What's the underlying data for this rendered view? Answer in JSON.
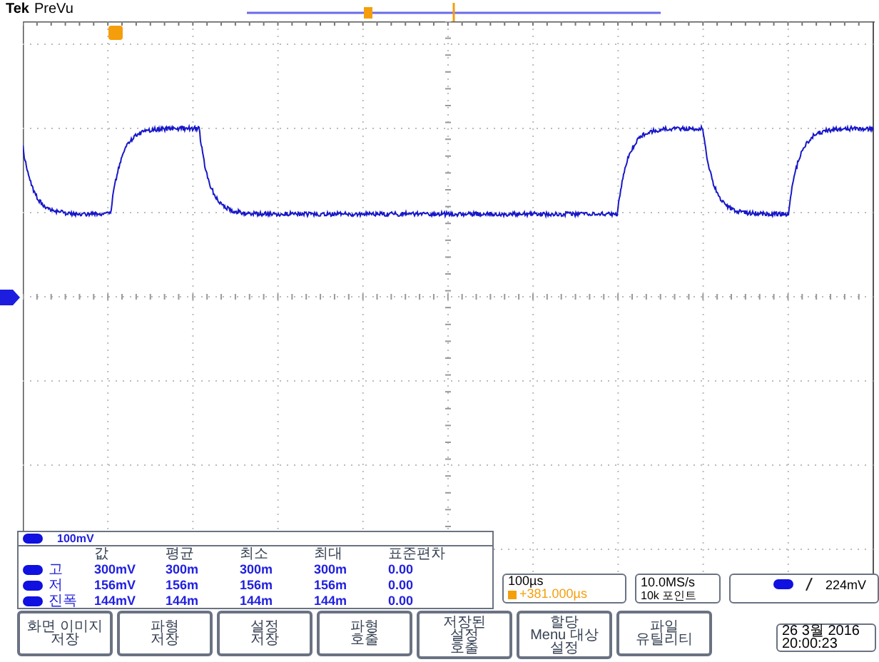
{
  "header": {
    "brand": "Tek",
    "mode": "PreVu"
  },
  "channel": {
    "scale": "100mV"
  },
  "measurements": {
    "columns": [
      "값",
      "평균",
      "최소",
      "최대",
      "표준편차"
    ],
    "rows": [
      {
        "label": "고",
        "values": [
          "300mV",
          "300m",
          "300m",
          "300m",
          "0.00"
        ]
      },
      {
        "label": "저",
        "values": [
          "156mV",
          "156m",
          "156m",
          "156m",
          "0.00"
        ]
      },
      {
        "label": "진폭",
        "values": [
          "144mV",
          "144m",
          "144m",
          "144m",
          "0.00"
        ]
      }
    ]
  },
  "timebase": {
    "scale": "100µs",
    "position": "+381.000µs"
  },
  "acquisition": {
    "rate": "10.0MS/s",
    "points": "10k 포인트"
  },
  "trigger": {
    "level": "224mV"
  },
  "menu": [
    {
      "lines": [
        "화면 이미지",
        "저장"
      ]
    },
    {
      "lines": [
        "파형",
        "저장"
      ]
    },
    {
      "lines": [
        "설정",
        "저장"
      ]
    },
    {
      "lines": [
        "파형",
        "호출"
      ]
    },
    {
      "lines": [
        "저장된",
        "설정",
        "호출"
      ]
    },
    {
      "lines": [
        "할당",
        "Menu 대상",
        "설정"
      ]
    },
    {
      "lines": [
        "파일",
        "유틸리티"
      ]
    }
  ],
  "datetime": {
    "date": "26 3월 2016",
    "time": "20:00:23"
  }
}
